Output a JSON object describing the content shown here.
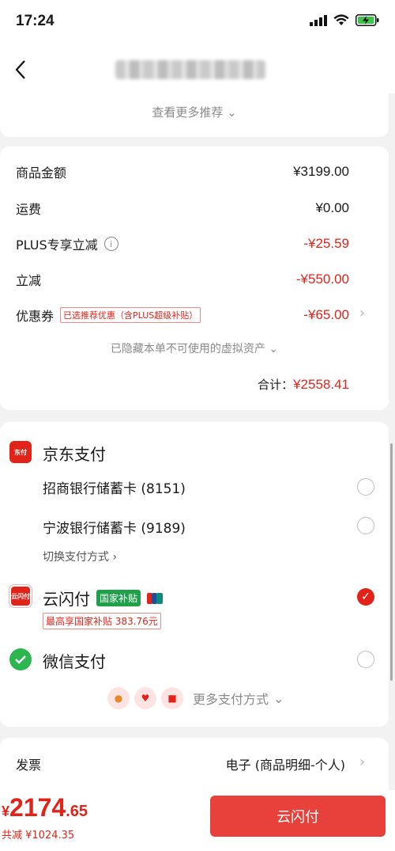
{
  "status_bar": {
    "time": "17:24"
  },
  "summary": {
    "see_more": "查看更多推荐",
    "rows": [
      {
        "label": "商品金额",
        "value": "¥3199.00"
      },
      {
        "label": "运费",
        "value": "¥0.00"
      },
      {
        "label": "PLUS专享立减",
        "value": "-¥25.59"
      },
      {
        "label": "立减",
        "value": "-¥550.00"
      },
      {
        "label": "优惠券",
        "tag": "已选推荐优惠（含PLUS超级补贴）",
        "value": "-¥65.00"
      }
    ],
    "hidden_note": "已隐藏本单不可使用的虚拟资产",
    "total_label": "合计：",
    "total_value": "¥2558.41"
  },
  "payment": {
    "jd_pay": {
      "title": "京东支付",
      "icon_text": "东付"
    },
    "cards": [
      "招商银行储蓄卡 (8151)",
      "宁波银行储蓄卡 (9189)"
    ],
    "switch_label": "切换支付方式",
    "unionpay": {
      "title": "云闪付",
      "badge": "国家补贴",
      "icon_text": "云闪付",
      "subsidy": "最高享国家补贴 383.76元"
    },
    "wechat": {
      "title": "微信支付"
    },
    "more_label": "更多支付方式"
  },
  "invoice": {
    "label": "发票",
    "value": "电子 (商品明细-个人)"
  },
  "bottom": {
    "currency": "¥",
    "price_int": "2174",
    "price_dec": ".65",
    "saving": "共减 ¥1024.35",
    "pay_button": "云闪付"
  },
  "colors": {
    "accent": "#e2231a",
    "button": "#e8403a",
    "green": "#1fa14a"
  }
}
